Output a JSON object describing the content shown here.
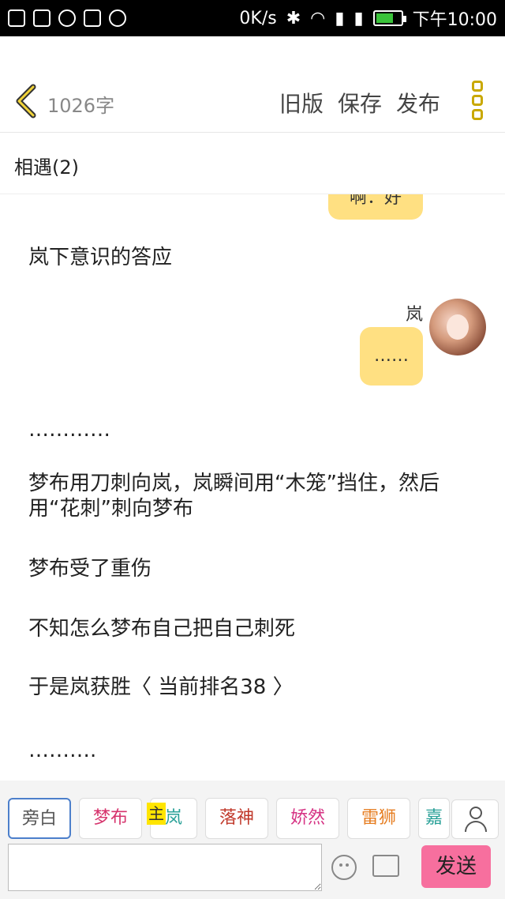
{
  "status_bar": {
    "speed": "0K/s",
    "time": "下午10:00",
    "battery_level": 0.7
  },
  "header": {
    "word_count": "1026字",
    "old_version": "旧版",
    "save": "保存",
    "publish": "发布"
  },
  "chapter": {
    "title": "相遇(2)"
  },
  "content": {
    "partial_bubble_text": "啊：好",
    "paragraphs": [
      "岚下意识的答应",
      "…………",
      "梦布用刀刺向岚，岚瞬间用“木笼”挡住，然后用“花刺”刺向梦布",
      "梦布受了重伤",
      "不知怎么梦布自己把自己刺死",
      "于是岚获胜〈 当前排名38 〉",
      "………."
    ],
    "speaker": {
      "name": "岚",
      "bubble_text": "……"
    }
  },
  "roles": [
    {
      "label": "旁白",
      "color": "#555555"
    },
    {
      "label": "梦布",
      "color": "#d6336c"
    },
    {
      "label": "岚",
      "color": "#2aa198"
    },
    {
      "label": "落神",
      "color": "#c0392b"
    },
    {
      "label": "娇然",
      "color": "#d63384"
    },
    {
      "label": "雷狮",
      "color": "#e67e22"
    },
    {
      "label": "嘉",
      "color": "#2aa198"
    }
  ],
  "main_badge": "主",
  "input": {
    "placeholder": "",
    "send_label": "发送"
  }
}
